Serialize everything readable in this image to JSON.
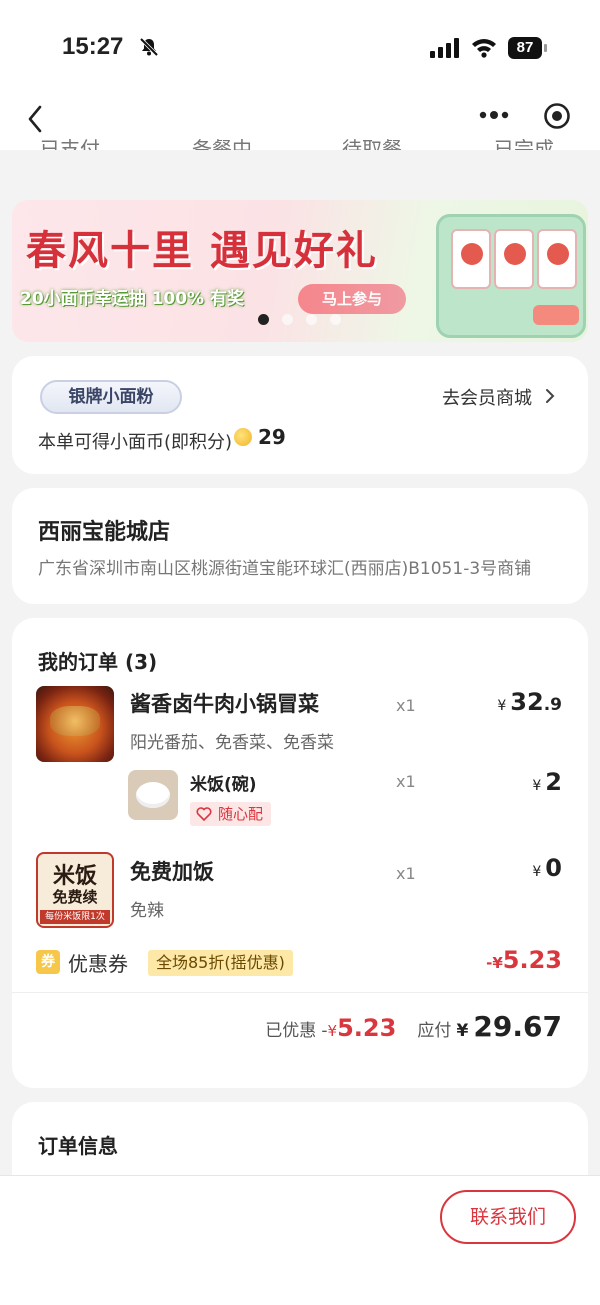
{
  "status_bar": {
    "time": "15:27",
    "battery": "87"
  },
  "nav": {
    "tabs_peek": [
      "已支付",
      "备餐中",
      "待取餐",
      "已完成"
    ]
  },
  "banner": {
    "title": "春风十里 遇见好礼",
    "subtitle": "20小面币幸运抽 100% 有奖",
    "cta": "马上参与",
    "page_count": 4,
    "active_page": 0
  },
  "member": {
    "level": "银牌小面粉",
    "mall_link": "去会员商城",
    "coin_text": "本单可得小面币(即积分)",
    "coin_amount": "29"
  },
  "store": {
    "name": "西丽宝能城店",
    "address": "广东省深圳市南山区桃源街道宝能环球汇(西丽店)B1051-3号商铺"
  },
  "order": {
    "title": "我的订单 (3)",
    "currency": "¥",
    "items": [
      {
        "name": "酱香卤牛肉小锅冒菜",
        "options": "阳光番茄、免香菜、免香菜",
        "qty": "x1",
        "price_int": "32",
        "price_dec": ".9"
      },
      {
        "name": "米饭(碗)",
        "tag": "随心配",
        "qty": "x1",
        "price_int": "2"
      },
      {
        "name": "免费加饭",
        "options": "免辣",
        "qty": "x1",
        "price_int": "0",
        "thumb_lines": [
          "米饭",
          "免费续",
          "每份米饭限1次"
        ]
      }
    ],
    "coupon": {
      "icon_text": "券",
      "label": "优惠券",
      "tag": "全场85折(摇优惠)",
      "prefix": "-",
      "amount": "5.23"
    },
    "summary": {
      "discount_label": "已优惠",
      "discount_prefix": "-",
      "discount": "5.23",
      "pay_label": "应付",
      "total": "29.67"
    }
  },
  "info": {
    "title": "订单信息"
  },
  "bottom": {
    "contact": "联系我们"
  }
}
